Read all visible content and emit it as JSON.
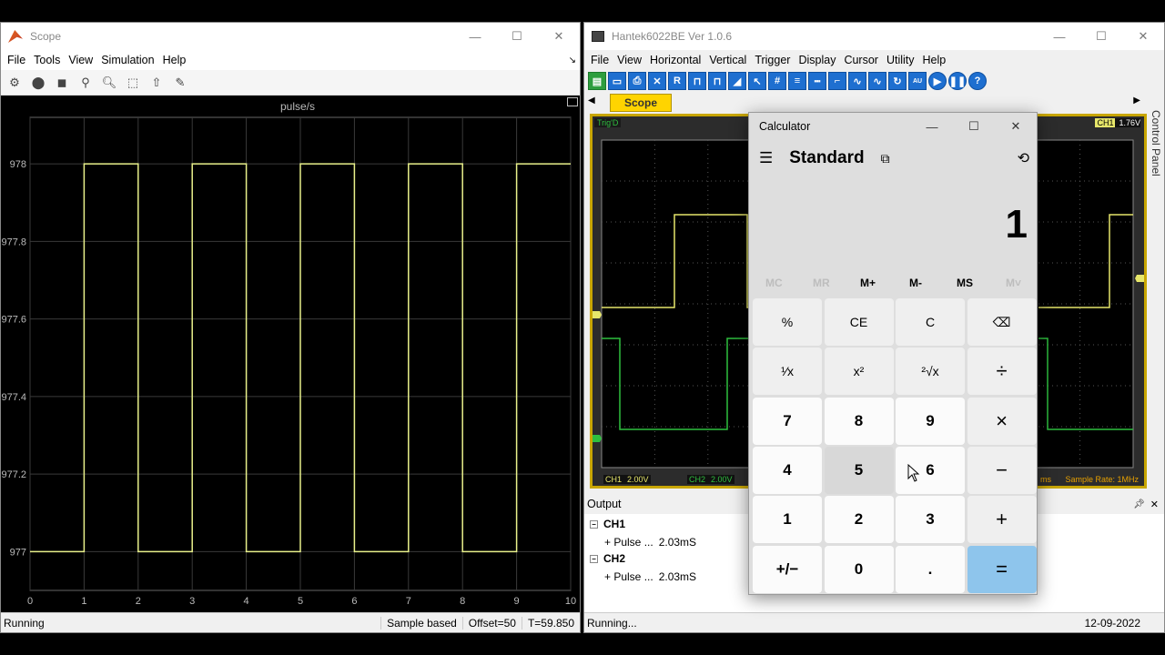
{
  "scope": {
    "title": "Scope",
    "menu": [
      "File",
      "Tools",
      "View",
      "Simulation",
      "Help"
    ],
    "plot_title": "pulse/s",
    "status_left": "Running",
    "status_mode": "Sample based",
    "status_offset": "Offset=50",
    "status_time": "T=59.850"
  },
  "chart_data": {
    "type": "line",
    "title": "pulse/s",
    "x_ticks": [
      "0",
      "1",
      "2",
      "3",
      "4",
      "5",
      "6",
      "7",
      "8",
      "9",
      "10"
    ],
    "y_ticks": [
      "977",
      "977.2",
      "977.4",
      "977.6",
      "977.8",
      "978"
    ],
    "xlim": [
      0,
      10
    ],
    "ylim": [
      976.9,
      978.12
    ],
    "grid": true,
    "series": [
      {
        "color": "#e8f08a",
        "points": [
          [
            0,
            977
          ],
          [
            1,
            977
          ],
          [
            1,
            978
          ],
          [
            2,
            978
          ],
          [
            2,
            977
          ],
          [
            3,
            977
          ],
          [
            3,
            978
          ],
          [
            4,
            978
          ],
          [
            4,
            977
          ],
          [
            5,
            977
          ],
          [
            5,
            978
          ],
          [
            6,
            978
          ],
          [
            6,
            977
          ],
          [
            7,
            977
          ],
          [
            7,
            978
          ],
          [
            8,
            978
          ],
          [
            8,
            977
          ],
          [
            9,
            977
          ],
          [
            9,
            978
          ],
          [
            10,
            978
          ]
        ]
      }
    ]
  },
  "hantek": {
    "title": "Hantek6022BE Ver 1.0.6",
    "menu": [
      "File",
      "View",
      "Horizontal",
      "Vertical",
      "Trigger",
      "Display",
      "Cursor",
      "Utility",
      "Help"
    ],
    "tab": "Scope",
    "side_panel": "Control Panel",
    "trig_label": "Trig'D",
    "ch1_indicator": "CH1",
    "trigger_level": "1.76V",
    "ch1_scale": "CH1",
    "ch1_volt": "2.00V",
    "ch2_scale": "CH2",
    "ch2_volt": "2.00V",
    "time_frag": "ms",
    "sample_rate": "Sample Rate: 1MHz",
    "output_title": "Output",
    "output_groups": [
      {
        "name": "CH1",
        "item": "+ Pulse ...",
        "value": "2.03mS"
      },
      {
        "name": "CH2",
        "item": "+ Pulse ...",
        "value": "2.03mS"
      }
    ],
    "status_left": "Running...",
    "status_date": "12-09-2022"
  },
  "calc": {
    "title": "Calculator",
    "mode": "Standard",
    "display": "1",
    "memory": [
      "MC",
      "MR",
      "M+",
      "M-",
      "MS",
      "M˅"
    ],
    "keys": [
      "%",
      "CE",
      "C",
      "⌫",
      "¹⁄x",
      "x²",
      "²√x",
      "÷",
      "7",
      "8",
      "9",
      "×",
      "4",
      "5",
      "6",
      "−",
      "1",
      "2",
      "3",
      "+",
      "+/−",
      "0",
      ".",
      "="
    ]
  },
  "colors": {
    "trace_scope": "#e8f08a",
    "ch1": "#e6e66a",
    "ch2": "#2fbf3f",
    "equals": "#8ec5ec",
    "hantek_accent": "#ffd400"
  }
}
